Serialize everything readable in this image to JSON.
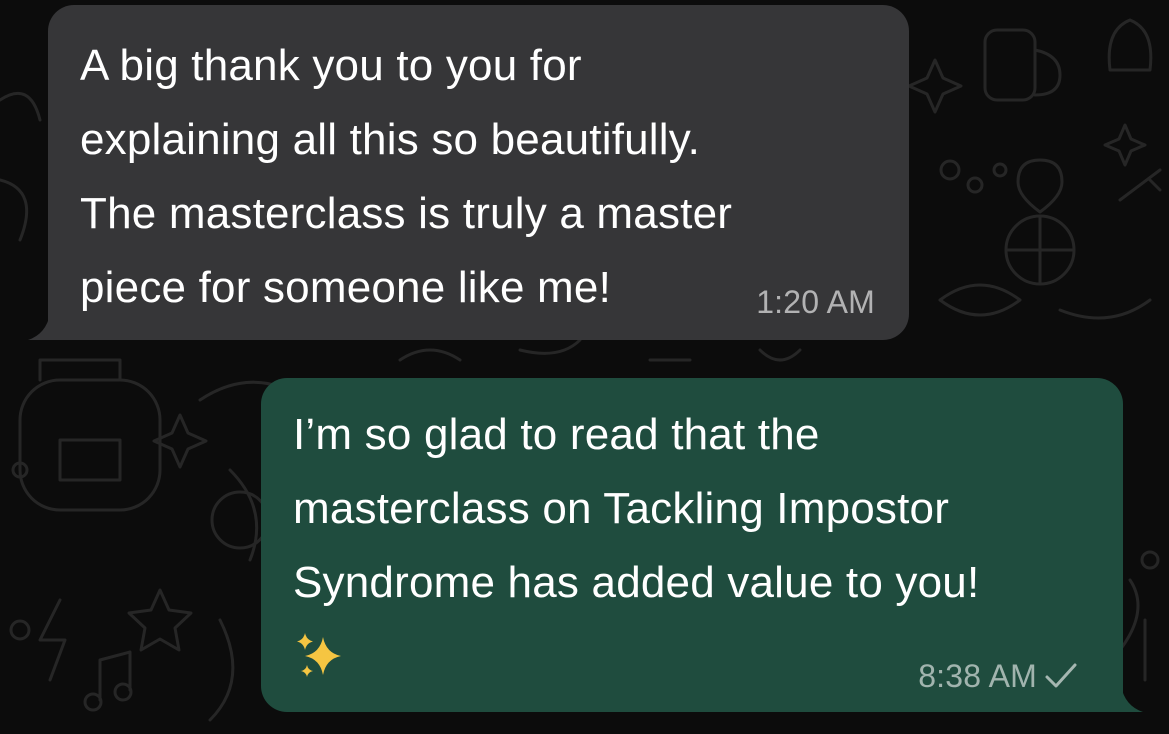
{
  "messages": [
    {
      "direction": "incoming",
      "text": "A big thank you to you for\nexplaining all this so beautifully.\nThe masterclass is truly a master\npiece for someone like me!",
      "time": "1:20 AM"
    },
    {
      "direction": "outgoing",
      "text": "I’m so glad to read that the\nmasterclass on Tackling Impostor\nSyndrome has added value to you!",
      "emoji": "sparkles",
      "time": "8:38 AM",
      "status_icon": "single-check-icon"
    }
  ],
  "colors": {
    "background": "#0c0c0c",
    "incoming_bubble": "#363638",
    "outgoing_bubble": "#1f4c3e",
    "text": "#ffffff",
    "sparkles": "#f5c542"
  }
}
